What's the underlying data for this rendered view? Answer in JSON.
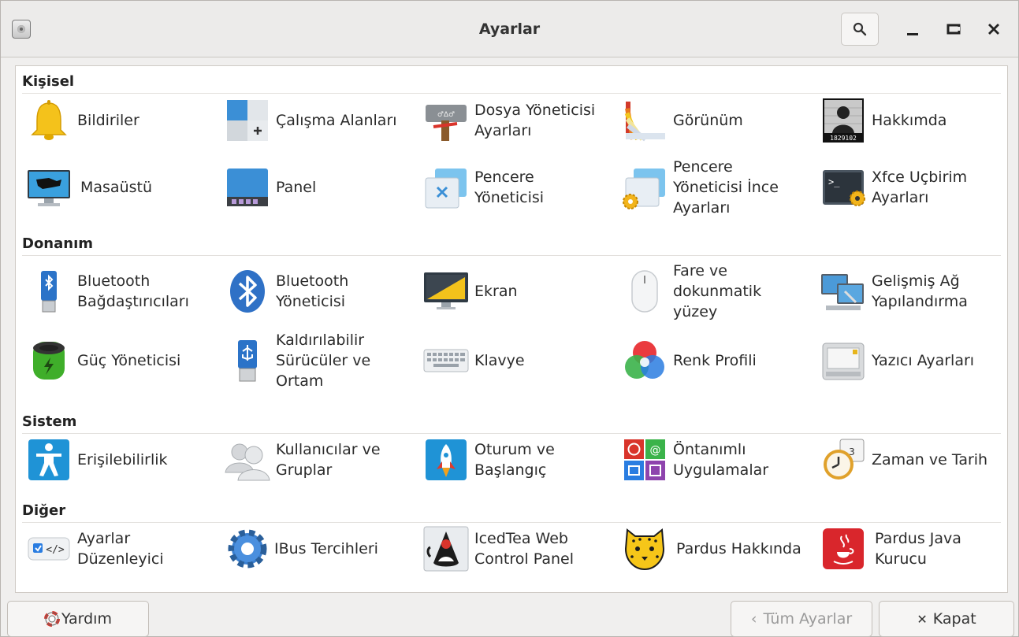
{
  "window": {
    "title": "Ayarlar"
  },
  "sections": [
    {
      "title": "Kişisel",
      "items": [
        {
          "label": "Bildiriler",
          "icon": "bell-icon"
        },
        {
          "label": "Çalışma Alanları",
          "icon": "workspaces-icon"
        },
        {
          "label": "Dosya Yöneticisi\nAyarları",
          "icon": "file-manager-icon"
        },
        {
          "label": "Görünüm",
          "icon": "appearance-icon"
        },
        {
          "label": "Hakkımda",
          "icon": "about-me-icon",
          "badge": "1829102"
        },
        {
          "label": "Masaüstü",
          "icon": "desktop-icon"
        },
        {
          "label": "Panel",
          "icon": "panel-icon"
        },
        {
          "label": "Pencere\nYöneticisi",
          "icon": "window-manager-icon"
        },
        {
          "label": "Pencere\nYöneticisi İnce\nAyarları",
          "icon": "window-manager-tweaks-icon"
        },
        {
          "label": "Xfce Uçbirim\nAyarları",
          "icon": "terminal-icon"
        }
      ]
    },
    {
      "title": "Donanım",
      "items": [
        {
          "label": "Bluetooth\nBağdaştırıcıları",
          "icon": "bluetooth-adapter-icon"
        },
        {
          "label": "Bluetooth\nYöneticisi",
          "icon": "bluetooth-icon"
        },
        {
          "label": "Ekran",
          "icon": "display-icon"
        },
        {
          "label": "Fare ve\ndokunmatik\nyüzey",
          "icon": "mouse-icon"
        },
        {
          "label": "Gelişmiş Ağ\nYapılandırma",
          "icon": "network-icon"
        },
        {
          "label": "Güç Yöneticisi",
          "icon": "battery-icon"
        },
        {
          "label": "Kaldırılabilir\nSürücüler ve\nOrtam",
          "icon": "usb-drive-icon"
        },
        {
          "label": "Klavye",
          "icon": "keyboard-icon"
        },
        {
          "label": "Renk Profili",
          "icon": "color-profile-icon"
        },
        {
          "label": "Yazıcı Ayarları",
          "icon": "printer-icon"
        }
      ]
    },
    {
      "title": "Sistem",
      "items": [
        {
          "label": "Erişilebilirlik",
          "icon": "accessibility-icon"
        },
        {
          "label": "Kullanıcılar ve\nGruplar",
          "icon": "users-icon"
        },
        {
          "label": "Oturum ve\nBaşlangıç",
          "icon": "rocket-icon"
        },
        {
          "label": "Öntanımlı\nUygulamalar",
          "icon": "default-apps-icon"
        },
        {
          "label": "Zaman ve Tarih",
          "icon": "clock-icon"
        }
      ]
    },
    {
      "title": "Diğer",
      "items": [
        {
          "label": "Ayarlar\nDüzenleyici",
          "icon": "settings-editor-icon"
        },
        {
          "label": "IBus Tercihleri",
          "icon": "gear-icon"
        },
        {
          "label": "IcedTea Web\nControl Panel",
          "icon": "java-duke-icon"
        },
        {
          "label": "Pardus Hakkında",
          "icon": "pardus-leopard-icon"
        },
        {
          "label": "Pardus Java\nKurucu",
          "icon": "java-installer-icon"
        }
      ]
    }
  ],
  "footer": {
    "help_label": "Yardım",
    "all_settings_label": "Tüm Ayarlar",
    "close_label": "Kapat"
  }
}
